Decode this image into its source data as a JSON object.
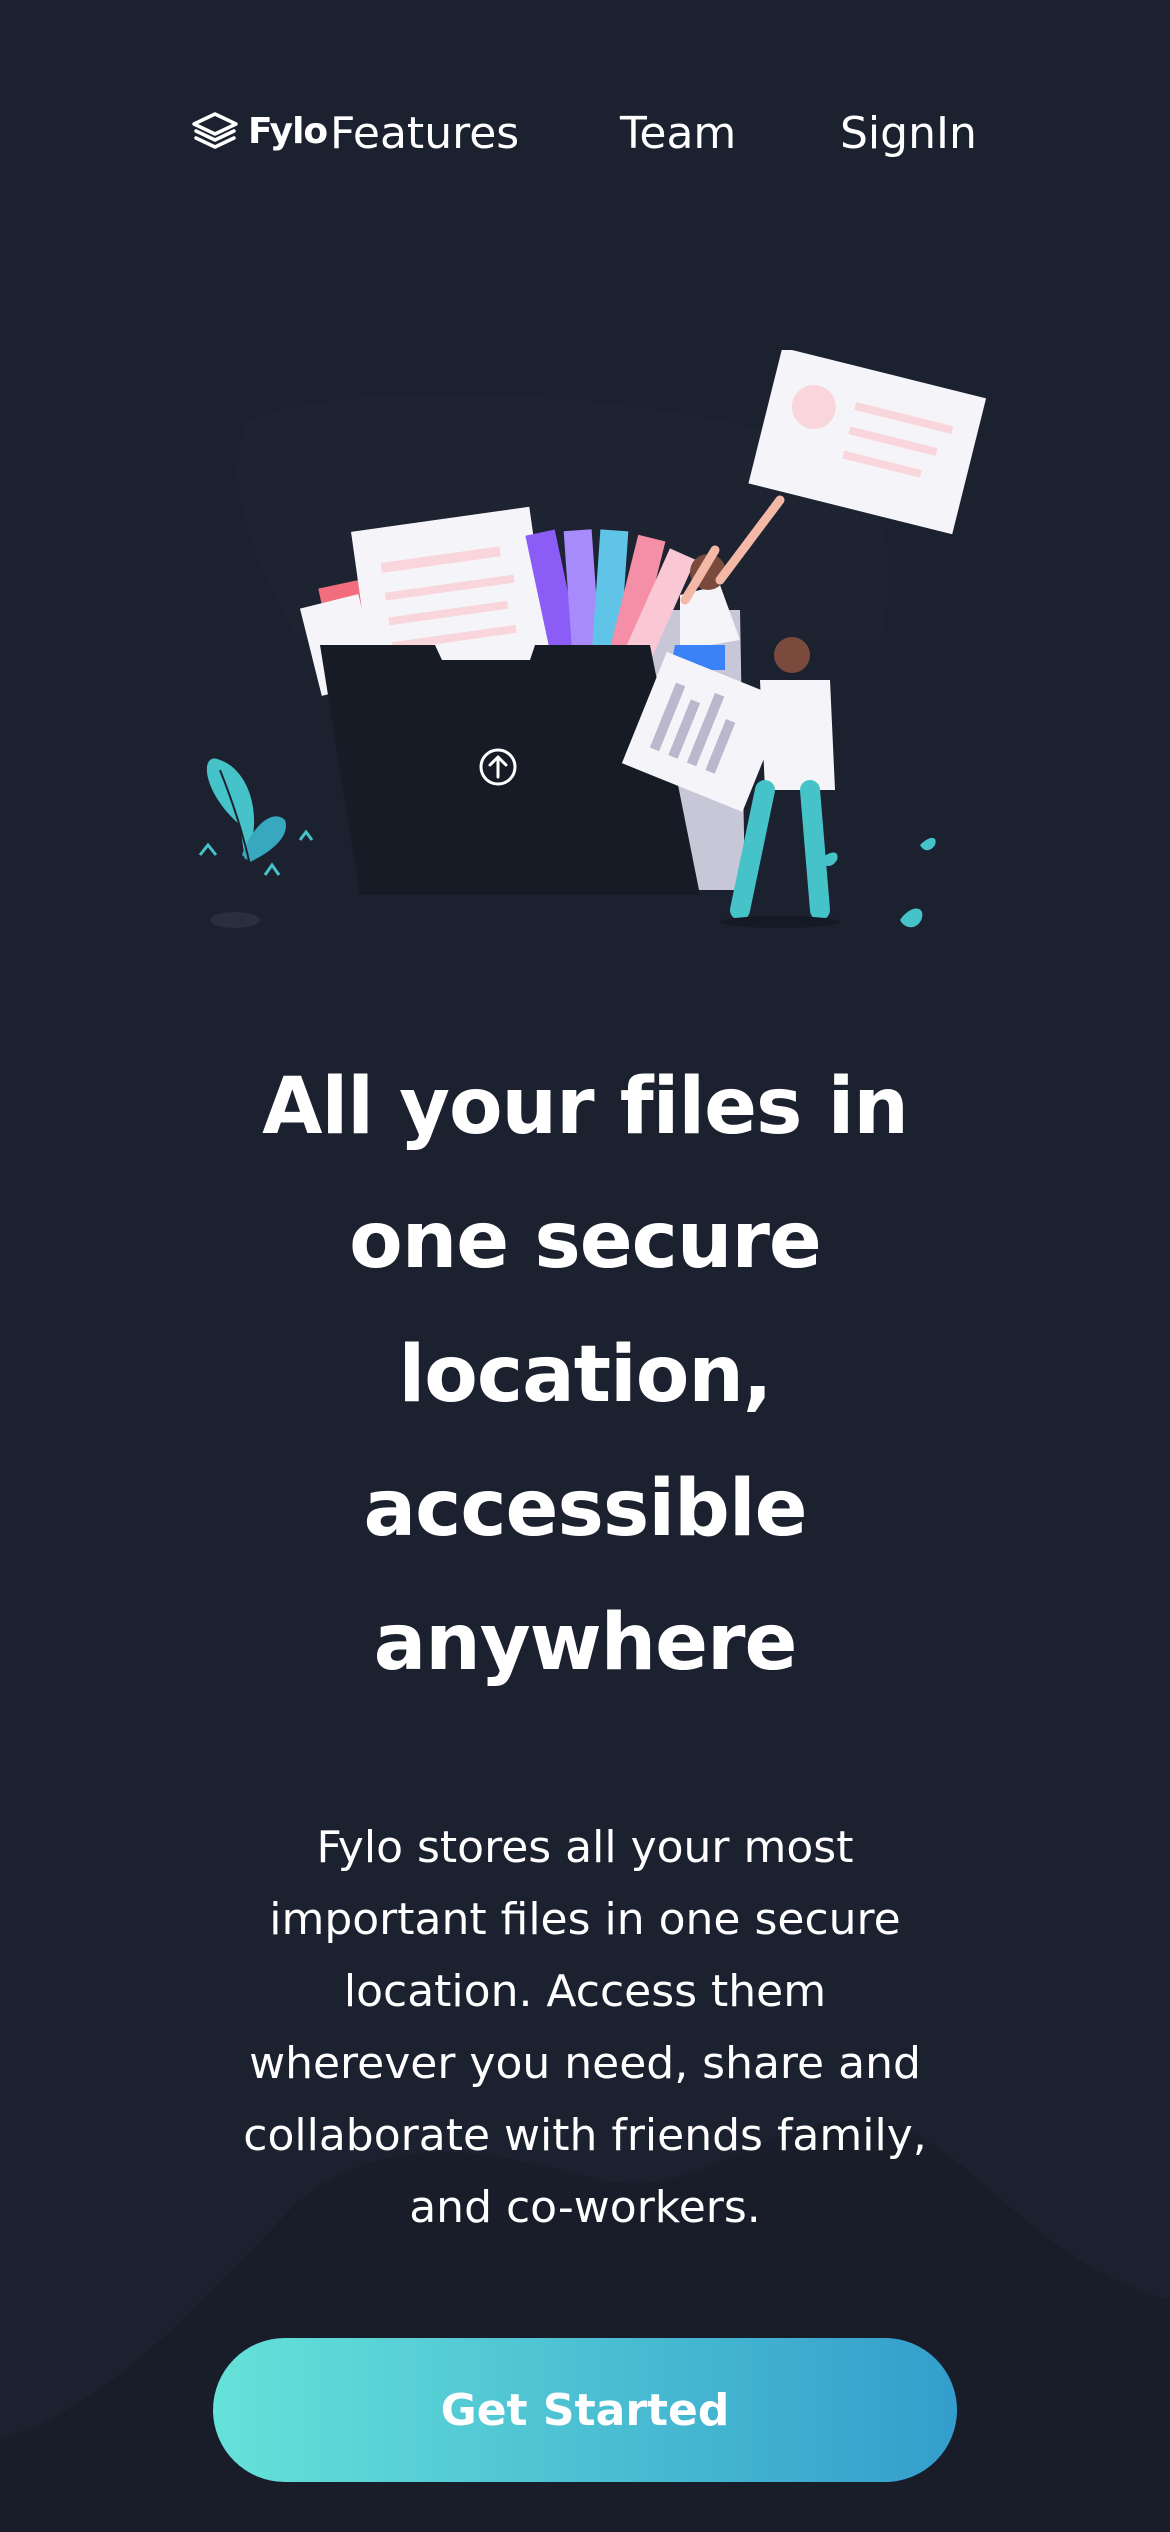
{
  "brand": {
    "logo_text": "Fylo",
    "logo_icon": "stacked-layers-icon"
  },
  "nav": {
    "items": [
      {
        "label": "Features"
      },
      {
        "label": "Team"
      },
      {
        "label": "SignIn"
      }
    ]
  },
  "hero": {
    "illustration": "folder-upload-people-illustration",
    "headline_lines": [
      "All your files in",
      "one secure",
      "location,",
      "accessible",
      "anywhere"
    ],
    "description_lines": [
      "Fylo stores all your most",
      "important files in one secure",
      "location. Access them",
      "wherever you need, share and",
      "collaborate with friends family,",
      "and co-workers."
    ],
    "cta_label": "Get Started"
  },
  "colors": {
    "background": "#1c2130",
    "background_curve": "#181d29",
    "cta_gradient_start": "#65e2d9",
    "cta_gradient_end": "#339ecc",
    "text": "#ffffff"
  }
}
